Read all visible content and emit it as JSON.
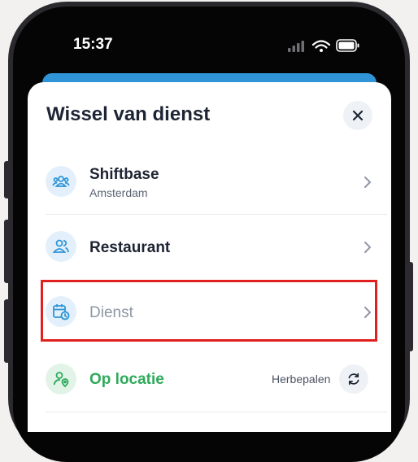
{
  "status_bar": {
    "time": "15:37"
  },
  "sheet": {
    "title": "Wissel van dienst",
    "items": [
      {
        "label": "Shiftbase",
        "sublabel": "Amsterdam",
        "icon": "team-icon"
      },
      {
        "label": "Restaurant",
        "icon": "users-icon"
      },
      {
        "label": "Dienst",
        "icon": "calendar-clock-icon",
        "state": "disabled"
      },
      {
        "label": "Op locatie",
        "icon": "user-location-icon",
        "action_label": "Herbepalen",
        "action_icon": "refresh-icon"
      }
    ]
  },
  "colors": {
    "accent_blue": "#2f95d8",
    "icon_bg": "#e3f0fb",
    "location_green": "#2eaa5a",
    "location_icon_bg": "#e2f4e8",
    "disabled_text": "#8e97a5",
    "highlight_border": "#e0201f"
  }
}
